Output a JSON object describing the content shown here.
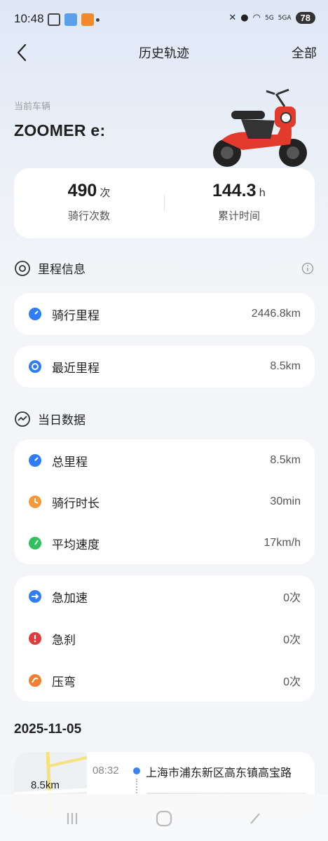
{
  "status": {
    "time": "10:48",
    "battery": "78",
    "network_5g_a": "5G",
    "network_5g_b": "5GA"
  },
  "nav": {
    "title": "历史轨迹",
    "right_action": "全部"
  },
  "vehicle": {
    "label": "当前车辆",
    "name": "ZOOMER e:"
  },
  "stats": {
    "rides": {
      "value": "490",
      "unit": "次",
      "label": "骑行次数"
    },
    "hours": {
      "value": "144.3",
      "unit": "h",
      "label": "累计时间"
    }
  },
  "mileage_section": {
    "title": "里程信息",
    "items": [
      {
        "label": "骑行里程",
        "value": "2446.8km",
        "icon": "speedometer-icon",
        "color": "#2f7cf6"
      },
      {
        "label": "最近里程",
        "value": "8.5km",
        "icon": "compass-icon",
        "color": "#2f7cf6"
      }
    ]
  },
  "daily_section": {
    "title": "当日数据",
    "items": [
      {
        "label": "总里程",
        "value": "8.5km",
        "icon": "speedometer-icon",
        "color": "#2f7cf6"
      },
      {
        "label": "骑行时长",
        "value": "30min",
        "icon": "clock-icon",
        "color": "#f29a3a"
      },
      {
        "label": "平均速度",
        "value": "17km/h",
        "icon": "speed-gauge-icon",
        "color": "#2fc25b"
      }
    ]
  },
  "behavior_section": {
    "items": [
      {
        "label": "急加速",
        "value": "0次",
        "icon": "acceleration-icon",
        "color": "#2f7cf6"
      },
      {
        "label": "急刹",
        "value": "0次",
        "icon": "brake-alert-icon",
        "color": "#e23b3b"
      },
      {
        "label": "压弯",
        "value": "0次",
        "icon": "lean-icon",
        "color": "#f07f2f"
      }
    ]
  },
  "trips": {
    "date": "2025-11-05",
    "items": [
      {
        "distance": "8.5km",
        "time": "08:32",
        "start_address": "上海市浦东新区高东镇高宝路"
      }
    ]
  },
  "colors": {
    "accent": "#2f7cf6",
    "scooter_red": "#e23b2e"
  }
}
